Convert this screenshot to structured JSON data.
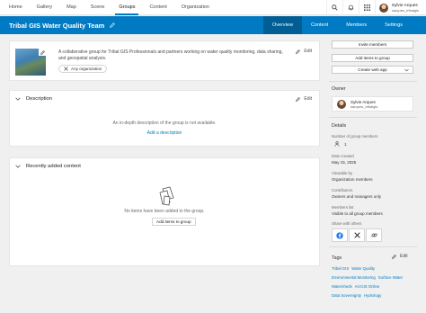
{
  "topnav": {
    "items": [
      "Home",
      "Gallery",
      "Map",
      "Scene",
      "Groups",
      "Content",
      "Organization"
    ],
    "active": "Groups",
    "user": {
      "name": "Sylvie Arques",
      "handle": "sarques_tribalgis"
    }
  },
  "header": {
    "title": "Tribal GIS Water Quality Team",
    "tabs": [
      "Overview",
      "Content",
      "Members",
      "Settings"
    ],
    "active_tab": "Overview",
    "accent": "#007ac2"
  },
  "overview": {
    "description": "A collaborative group for Tribal GIS Professionals and partners working on water quality monitoring, data sharing, and geospatial analysis.",
    "edit_label": "Edit",
    "org_chip": "Any organization"
  },
  "description_section": {
    "title": "Description",
    "edit_label": "Edit",
    "empty_text": "An in-depth description of the group is not available.",
    "add_link": "Add a description"
  },
  "recent_section": {
    "title": "Recently added content",
    "empty_text": "No items have been added to the group.",
    "add_button": "Add items to group"
  },
  "actions": {
    "invite": "Invite members",
    "add_items": "Add items to group",
    "create_web_app": "Create web app"
  },
  "owner": {
    "label": "Owner",
    "name": "Sylvie Arques",
    "handle": "sarques_tribalgis"
  },
  "details": {
    "title": "Details",
    "members_label": "Number of group members",
    "members_count": "1",
    "created_label": "Date created",
    "created_value": "May 15, 2025",
    "viewable_label": "Viewable by",
    "viewable_value": "Organization members",
    "contributors_label": "Contributors",
    "contributors_value": "Owners and managers only",
    "memberslist_label": "Members list",
    "memberslist_value": "Visible to all group members",
    "share_label": "Share with others"
  },
  "tags": {
    "title": "Tags",
    "edit_label": "Edit",
    "rows": [
      [
        "Tribal GIS",
        "Water Quality"
      ],
      [
        "Environmental Monitoring",
        "Surface Water"
      ],
      [
        "Watersheds",
        "ArcGIS Online"
      ],
      [
        "Data Sovereignty",
        "Hydrology"
      ]
    ]
  }
}
